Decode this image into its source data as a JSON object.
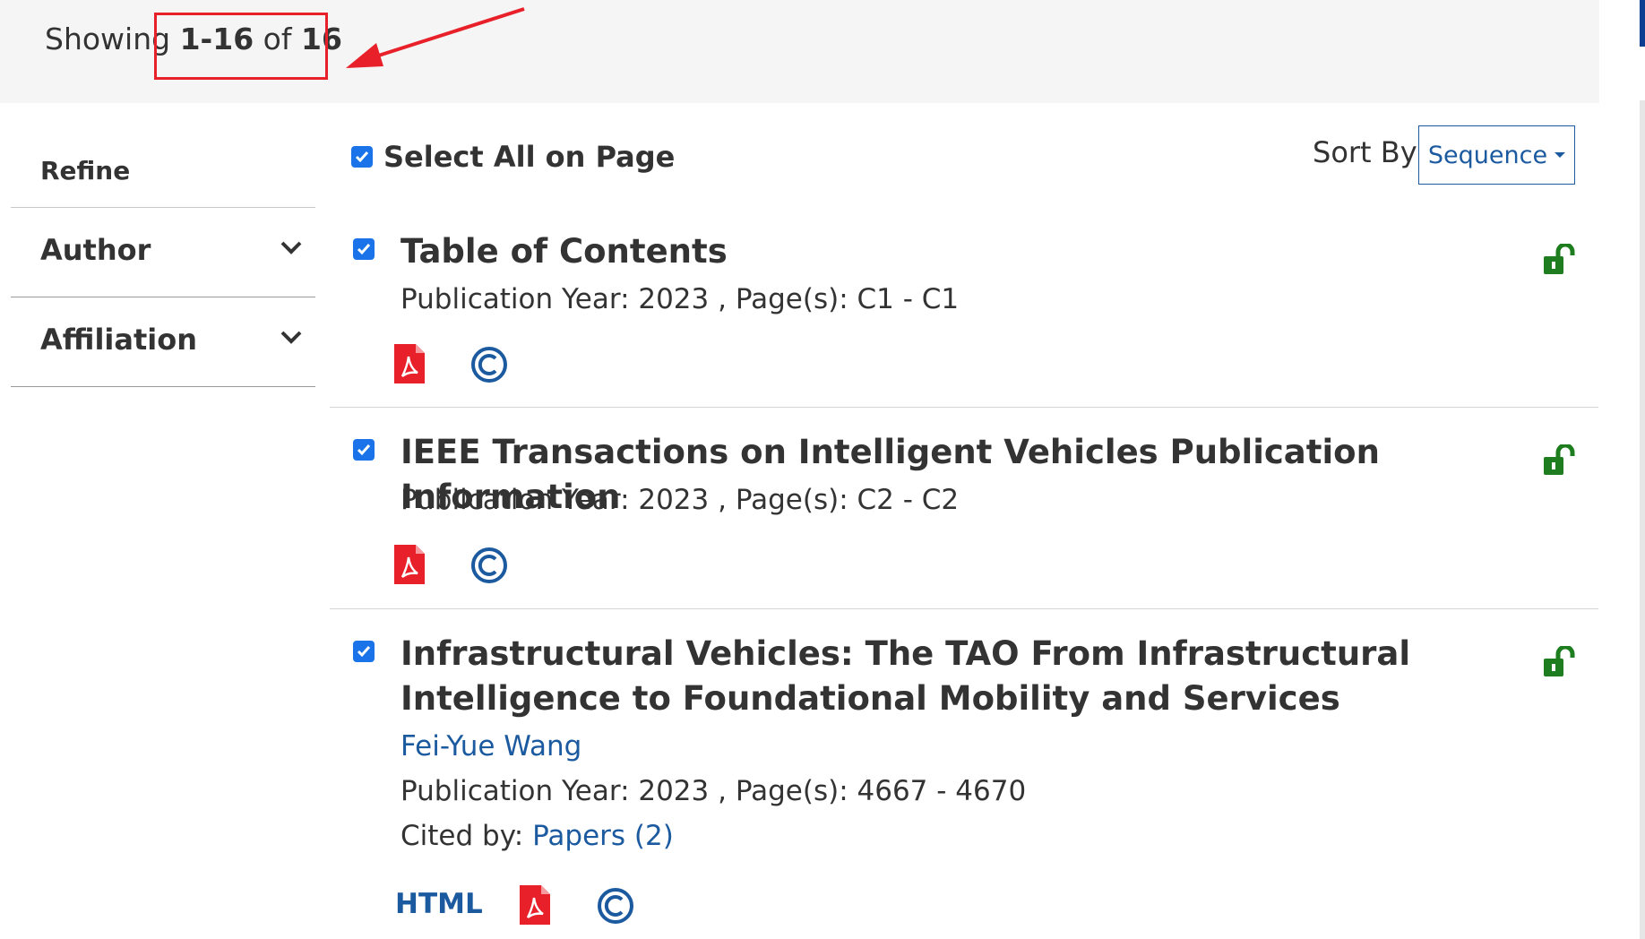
{
  "header": {
    "showing_prefix": "Showing",
    "range": "1-16",
    "of": "of",
    "total": "16"
  },
  "sidebar": {
    "refine": "Refine",
    "facets": [
      "Author",
      "Affiliation"
    ]
  },
  "toolbar": {
    "select_all": "Select All on Page",
    "sort_by": "Sort By",
    "sort_value": "Sequence"
  },
  "results": [
    {
      "title": "Table of Contents",
      "meta": "Publication Year: 2023 , Page(s): C1  -  C1"
    },
    {
      "title": "IEEE Transactions on Intelligent Vehicles Publication Information",
      "meta": "Publication Year: 2023 , Page(s): C2  -  C2"
    },
    {
      "title": "Infrastructural Vehicles: The TAO From Infrastructural Intelligence to Foundational Mobility and Services",
      "author": "Fei-Yue Wang",
      "meta": "Publication Year: 2023 , Page(s): 4667  -  4670",
      "cited_label": "Cited by:",
      "cited_link": "Papers (2)",
      "html_label": "HTML"
    }
  ],
  "colors": {
    "link": "#1c5aa0",
    "pdf": "#e8202a",
    "lock": "#1e7d1e",
    "checkbox": "#1a73e8",
    "highlight": "#e8202a"
  }
}
